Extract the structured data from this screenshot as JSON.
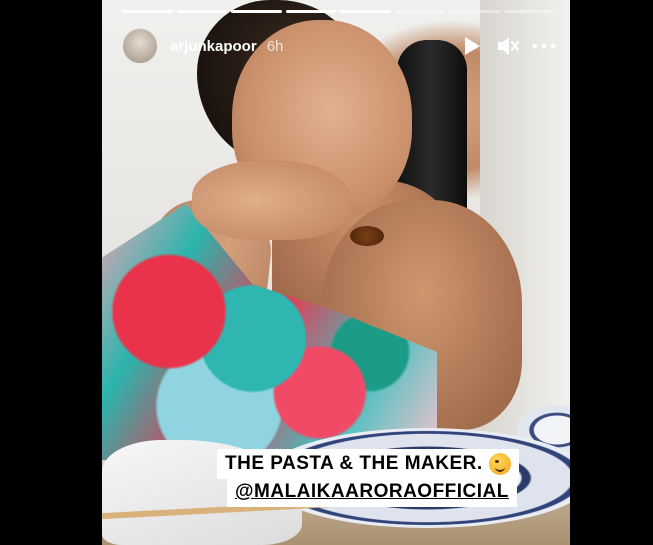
{
  "story": {
    "progress": {
      "total_segments": 8,
      "filled_segments": 5
    },
    "header": {
      "username": "arjunkapoor",
      "time": "6h",
      "play_icon": "play-icon",
      "mute_icon": "mute-icon",
      "more_icon": "more-options-icon"
    },
    "caption": {
      "line1": "THE PASTA & THE MAKER.",
      "emoji": "winking-face",
      "line2": "@MALAIKAARORAOFFICIAL"
    }
  }
}
